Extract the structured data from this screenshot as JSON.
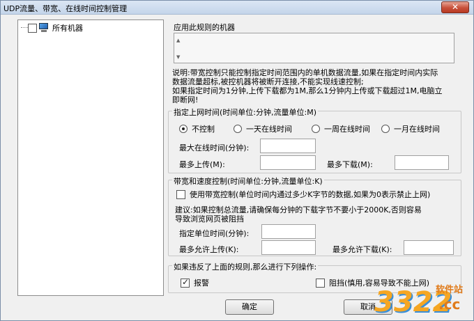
{
  "window": {
    "title": "UDP流量、带宽、在线时间控制管理",
    "close_glyph": "✕"
  },
  "tree": {
    "root_label": "所有机器",
    "root_checked": false
  },
  "applied_machines": {
    "label": "应用此规则的机器",
    "scroll_up": "▲",
    "scroll_down": "▼"
  },
  "description": {
    "line1": "说明:带宽控制只能控制指定时间范围内的单机数据流量,如果在指定时间内实际",
    "line2": "数据流量超标,被控机器将被断开连接,不能实现线速控制;",
    "line3": "如果指定时间为1分钟,上传下载都为1M,那么1分钟内上传或下载超过1M,电脑立",
    "line4": "即断网!"
  },
  "online_time": {
    "group_title": "指定上网时间(时间单位:分钟,流量单位:M)",
    "options": [
      {
        "label": "不控制",
        "checked": true
      },
      {
        "label": "一天在线时间",
        "checked": false
      },
      {
        "label": "一周在线时间",
        "checked": false
      },
      {
        "label": "一月在线时间",
        "checked": false
      }
    ],
    "max_online_label": "最大在线时间(分钟):",
    "max_online_value": "",
    "max_upload_label": "最多上传(M):",
    "max_upload_value": "",
    "max_download_label": "最多下载(M):",
    "max_download_value": ""
  },
  "bandwidth": {
    "group_title": "带宽和速度控制(时间单位:分钟,流量单位:K)",
    "enable_label": "使用带宽控制(单位时间内通过多少K字节的数据,如果为0表示禁止上网)",
    "enable_checked": false,
    "advice_line1": "建议:如果控制总流量,请确保每分钟的下载字节不要小于2000K,否则容易",
    "advice_line2": "导致浏览网页被阻挡",
    "unit_time_label": "指定单位时间(分钟):",
    "unit_time_value": "",
    "max_upload_label": "最多允许上传(K):",
    "max_upload_value": "",
    "max_download_label": "最多允许下载(K):",
    "max_download_value": ""
  },
  "violation": {
    "group_title": "如果违反了上面的规则,那么进行下列操作:",
    "alarm_label": "报警",
    "alarm_checked": true,
    "block_label": "阻挡(慎用,容易导致不能上网)",
    "block_checked": false
  },
  "buttons": {
    "ok_label": "确定",
    "cancel_label": "取消"
  },
  "watermark": {
    "number": "3322",
    "site_label": "软件站",
    "domain": ".cc",
    "primary_color": "#f5a623",
    "accent_color": "#3a8fd8"
  }
}
